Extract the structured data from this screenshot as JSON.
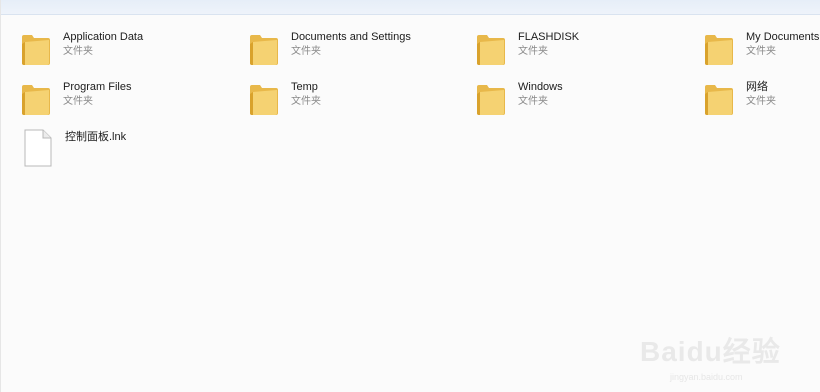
{
  "folders": [
    {
      "name": "Application Data",
      "type": "文件夹"
    },
    {
      "name": "Documents and Settings",
      "type": "文件夹"
    },
    {
      "name": "FLASHDISK",
      "type": "文件夹"
    },
    {
      "name": "My Documents",
      "type": "文件夹"
    },
    {
      "name": "Program Files",
      "type": "文件夹"
    },
    {
      "name": "Temp",
      "type": "文件夹"
    },
    {
      "name": "Windows",
      "type": "文件夹"
    },
    {
      "name": "网络",
      "type": "文件夹"
    }
  ],
  "files": [
    {
      "name": "控制面板.lnk",
      "icon": "document-icon"
    }
  ],
  "watermark": {
    "text": "Baidu经验",
    "sub": "jingyan.baidu.com"
  },
  "colors": {
    "folder": "#f2c94c",
    "folder_dark": "#d9a92a",
    "accent_strip": "#e6eef8"
  }
}
